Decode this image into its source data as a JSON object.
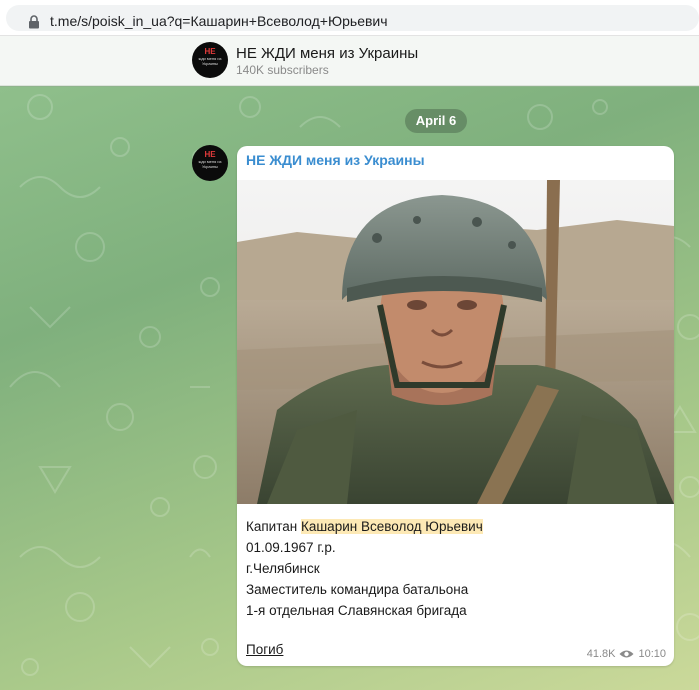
{
  "browser": {
    "url": "t.me/s/poisk_in_ua?q=Кашарин+Всеволод+Юрьевич"
  },
  "channel": {
    "title": "НЕ ЖДИ меня из Украины",
    "subscribers": "140K subscribers",
    "avatar_line1": "НЕ",
    "avatar_line2": "жди меня из Украины"
  },
  "feed": {
    "date_label": "April 6",
    "message": {
      "author": "НЕ ЖДИ меня из Украины",
      "caption": {
        "rank": "Капитан",
        "name": "Кашарин Всеволод Юрьевич",
        "birth_date": "01.09.1967 г.р.",
        "city": "г.Челябинск",
        "position": "Заместитель командира батальона",
        "unit": "1-я отдельная Славянская бригада"
      },
      "tag": "Погиб",
      "views": "41.8K",
      "time": "10:10"
    }
  },
  "colors": {
    "author_link": "#3a8dd0",
    "highlight": "#fde9b5",
    "date_pill": "#6e8e6a"
  }
}
